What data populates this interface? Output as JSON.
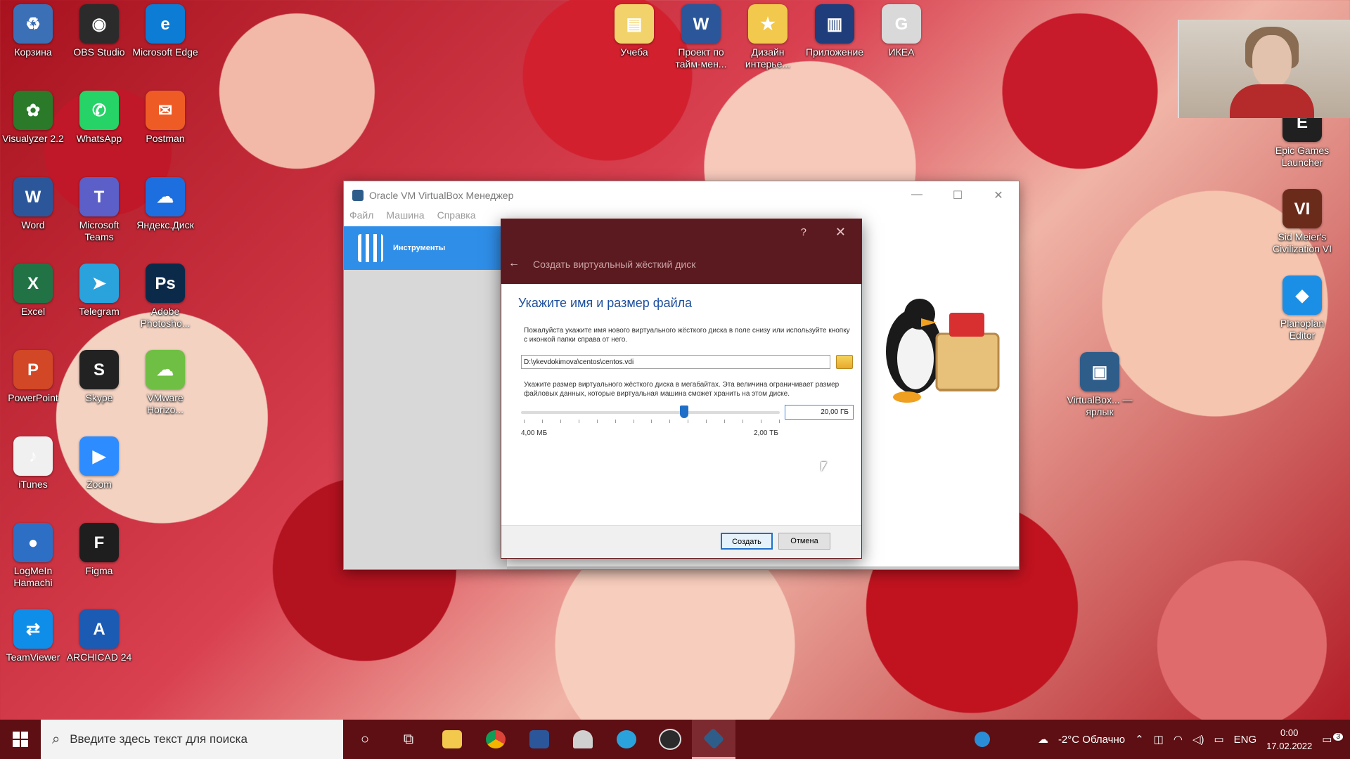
{
  "desktop": {
    "col1": [
      {
        "label": "Корзина",
        "glyph": "♻",
        "color": "#3b6fb6",
        "icon": "recycle-bin-icon"
      },
      {
        "label": "Visualyzer 2.2",
        "glyph": "✿",
        "color": "#2a7a2a",
        "icon": "visualyzer-icon"
      },
      {
        "label": "Word",
        "glyph": "W",
        "color": "#2b579a",
        "icon": "word-icon"
      },
      {
        "label": "Excel",
        "glyph": "X",
        "color": "#217346",
        "icon": "excel-icon"
      },
      {
        "label": "PowerPoint",
        "glyph": "P",
        "color": "#d24726",
        "icon": "powerpoint-icon"
      },
      {
        "label": "iTunes",
        "glyph": "♪",
        "color": "#f0f0f0",
        "icon": "itunes-icon"
      },
      {
        "label": "LogMeIn Hamachi",
        "glyph": "●",
        "color": "#2d6fc4",
        "icon": "hamachi-icon"
      },
      {
        "label": "TeamViewer",
        "glyph": "⇄",
        "color": "#0e8ee9",
        "icon": "teamviewer-icon"
      }
    ],
    "col2": [
      {
        "label": "OBS Studio",
        "glyph": "◉",
        "color": "#2b2b2b",
        "icon": "obs-icon"
      },
      {
        "label": "WhatsApp",
        "glyph": "✆",
        "color": "#25d366",
        "icon": "whatsapp-icon"
      },
      {
        "label": "Microsoft Teams",
        "glyph": "T",
        "color": "#5b5fc7",
        "icon": "teams-icon"
      },
      {
        "label": "Telegram",
        "glyph": "➤",
        "color": "#2aa3dd",
        "icon": "telegram-icon"
      },
      {
        "label": "Skype",
        "glyph": "S",
        "color": "#222222",
        "icon": "skype-icon"
      },
      {
        "label": "Zoom",
        "glyph": "▶",
        "color": "#2d8cff",
        "icon": "zoom-icon"
      },
      {
        "label": "Figma",
        "glyph": "F",
        "color": "#1e1e1e",
        "icon": "figma-icon"
      },
      {
        "label": "ARCHICAD 24",
        "glyph": "A",
        "color": "#1b5bb3",
        "icon": "archicad-icon"
      }
    ],
    "col3": [
      {
        "label": "Microsoft Edge",
        "glyph": "e",
        "color": "#0c7cd5",
        "icon": "edge-icon"
      },
      {
        "label": "Postman",
        "glyph": "✉",
        "color": "#ef5b25",
        "icon": "postman-icon"
      },
      {
        "label": "Яндекс.Диск",
        "glyph": "☁",
        "color": "#1d6fe0",
        "icon": "yandex-disk-icon"
      },
      {
        "label": "Adobe Photosho...",
        "glyph": "Ps",
        "color": "#0b2a4a",
        "icon": "photoshop-icon"
      },
      {
        "label": "VMware Horizo...",
        "glyph": "☁",
        "color": "#6fbf44",
        "icon": "vmware-icon"
      }
    ],
    "top": [
      {
        "label": "Учеба",
        "glyph": "▤",
        "color": "#f2d36b",
        "icon": "folder-icon"
      },
      {
        "label": "Проект по тайм-мен...",
        "glyph": "W",
        "color": "#2b579a",
        "icon": "word-doc-icon"
      },
      {
        "label": "Дизайн интерье...",
        "glyph": "★",
        "color": "#f2c94c",
        "icon": "folder-star-icon"
      },
      {
        "label": "Приложение",
        "glyph": "▥",
        "color": "#1f3d7a",
        "icon": "archive-icon"
      },
      {
        "label": "ИКЕА",
        "glyph": "G",
        "color": "#d9d9d9",
        "icon": "ikea-file-icon"
      }
    ],
    "right": [
      {
        "label": "Epic Games Launcher",
        "glyph": "E",
        "color": "#202020",
        "icon": "epic-games-icon"
      },
      {
        "label": "Sid Meier's Civilization VI",
        "glyph": "VI",
        "color": "#6b2b1b",
        "icon": "civ6-icon"
      },
      {
        "label": "Planoplan Editor",
        "glyph": "◆",
        "color": "#1b8fe6",
        "icon": "planoplan-icon"
      },
      {
        "label": "VirtualBox... — ярлык",
        "glyph": "▣",
        "color": "#2f5d8a",
        "icon": "virtualbox-shortcut-icon"
      }
    ]
  },
  "vbox": {
    "title": "Oracle VM VirtualBox Менеджер",
    "menu": [
      "Файл",
      "Машина",
      "Справка"
    ],
    "tools_label": "Инструменты",
    "controls": {
      "minimize": "—",
      "maximize": "☐",
      "close": "✕"
    }
  },
  "dialog": {
    "help": "?",
    "close": "✕",
    "back": "←",
    "subtitle": "Создать виртуальный жёсткий диск",
    "heading": "Укажите имя и размер файла",
    "intro": "Пожалуйста укажите имя нового виртуального жёсткого диска в поле снизу или используйте кнопку с иконкой папки справа от него.",
    "path_value": "D:\\ykevdokimova\\centos\\centos.vdi",
    "size_hint": "Укажите размер виртуального жёсткого диска в мегабайтах. Эта величина ограничивает размер файловых данных, которые виртуальная машина сможет хранить на этом диске.",
    "slider_position": 0.63,
    "min_label": "4,00 МБ",
    "max_label": "2,00 ТБ",
    "size_value": "20,00 ГБ",
    "create_btn": "Создать",
    "cancel_btn": "Отмена"
  },
  "taskbar": {
    "search_placeholder": "Введите здесь текст для поиска",
    "weather": "-2°C Облачно",
    "lang": "ENG",
    "time": "0:00",
    "date": "17.02.2022",
    "notif_count": "3"
  },
  "colors": {
    "dialog_header": "#5b1a1f",
    "taskbar": "#5d0f13",
    "accent": "#1f6fc9",
    "heading": "#1e4f9c"
  }
}
